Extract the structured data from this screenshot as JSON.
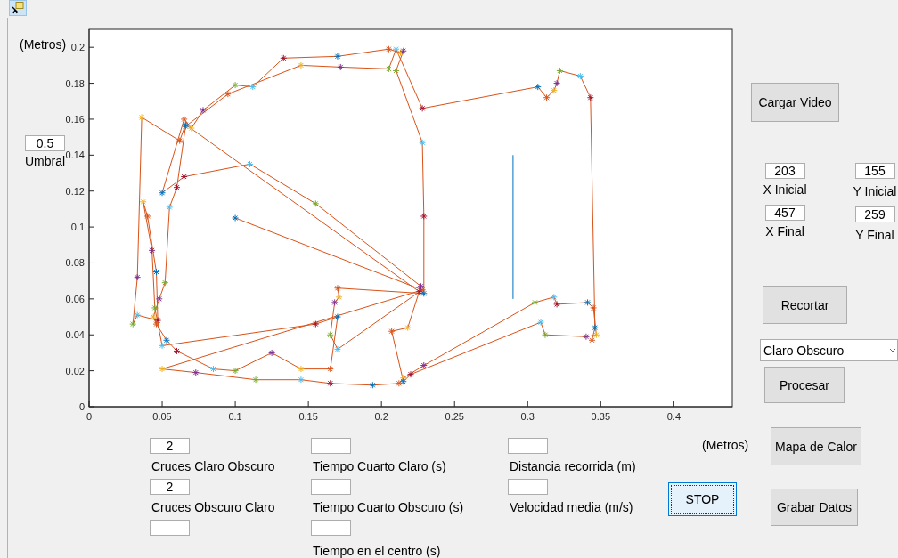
{
  "threshold": {
    "value": "0.5",
    "label": "Umbral"
  },
  "plot": {
    "y_unit": "(Metros)",
    "chart_data": {
      "type": "line",
      "xlim": [
        0,
        0.44
      ],
      "ylim": [
        0,
        0.21
      ],
      "xticks": [
        {
          "value": 0,
          "label": "0"
        },
        {
          "value": 0.05,
          "label": "0.05"
        },
        {
          "value": 0.1,
          "label": "0.1"
        },
        {
          "value": 0.15,
          "label": "0.15"
        },
        {
          "value": 0.2,
          "label": "0.2"
        },
        {
          "value": 0.25,
          "label": "0.25"
        },
        {
          "value": 0.3,
          "label": "0.3"
        },
        {
          "value": 0.35,
          "label": "0.35"
        },
        {
          "value": 0.4,
          "label": "0.4"
        }
      ],
      "yticks": [
        {
          "value": 0,
          "label": "0"
        },
        {
          "value": 0.02,
          "label": "0.02"
        },
        {
          "value": 0.04,
          "label": "0.04"
        },
        {
          "value": 0.06,
          "label": "0.06"
        },
        {
          "value": 0.08,
          "label": "0.08"
        },
        {
          "value": 0.1,
          "label": "0.1"
        },
        {
          "value": 0.12,
          "label": "0.12"
        },
        {
          "value": 0.14,
          "label": "0.14"
        },
        {
          "value": 0.16,
          "label": "0.16"
        },
        {
          "value": 0.18,
          "label": "0.18"
        },
        {
          "value": 0.2,
          "label": "0.2"
        }
      ],
      "series": [
        {
          "color": "#d95319",
          "marker": "cross",
          "x": [
            0.1,
            0.228,
            0.05,
            0.073,
            0.114,
            0.145,
            0.165,
            0.194,
            0.212,
            0.215,
            0.229,
            0.305,
            0.318,
            0.32,
            0.341,
            0.345,
            0.347,
            0.34,
            0.312,
            0.309,
            0.22,
            0.215,
            0.207,
            0.218,
            0.227,
            0.155,
            0.11,
            0.065,
            0.05,
            0.065,
            0.07,
            0.078,
            0.1,
            0.112,
            0.133,
            0.17,
            0.205,
            0.213,
            0.215,
            0.21,
            0.228,
            0.229,
            0.229,
            0.17,
            0.171,
            0.168,
            0.165,
            0.17,
            0.226,
            0.066,
            0.062,
            0.036,
            0.033,
            0.03,
            0.033,
            0.047,
            0.046,
            0.04,
            0.037,
            0.043,
            0.045,
            0.05,
            0.155,
            0.17,
            0.165,
            0.145,
            0.125,
            0.1,
            0.085,
            0.06,
            0.053,
            0.046,
            0.044,
            0.048,
            0.052,
            0.055,
            0.06,
            0.066,
            0.095,
            0.145,
            0.172,
            0.205,
            0.21,
            0.228,
            0.307,
            0.313,
            0.318,
            0.32,
            0.322,
            0.336,
            0.343,
            0.346,
            0.344
          ],
          "values": [
            0.105,
            0.065,
            0.021,
            0.019,
            0.015,
            0.015,
            0.013,
            0.012,
            0.013,
            0.016,
            0.023,
            0.058,
            0.061,
            0.057,
            0.058,
            0.055,
            0.04,
            0.039,
            0.04,
            0.047,
            0.018,
            0.014,
            0.042,
            0.044,
            0.067,
            0.113,
            0.135,
            0.128,
            0.119,
            0.16,
            0.155,
            0.165,
            0.179,
            0.178,
            0.194,
            0.195,
            0.199,
            0.197,
            0.198,
            0.187,
            0.147,
            0.106,
            0.063,
            0.066,
            0.061,
            0.058,
            0.04,
            0.032,
            0.064,
            0.157,
            0.148,
            0.161,
            0.072,
            0.046,
            0.051,
            0.048,
            0.075,
            0.106,
            0.114,
            0.087,
            0.055,
            0.034,
            0.046,
            0.05,
            0.021,
            0.021,
            0.03,
            0.02,
            0.021,
            0.031,
            0.037,
            0.046,
            0.05,
            0.06,
            0.069,
            0.111,
            0.122,
            0.156,
            0.174,
            0.19,
            0.189,
            0.188,
            0.199,
            0.166,
            0.178,
            0.172,
            0.176,
            0.18,
            0.187,
            0.184,
            0.172,
            0.044,
            0.037
          ]
        },
        {
          "color": "#0072bd",
          "x": [
            0.29,
            0.29
          ],
          "values": [
            0.06,
            0.14
          ]
        }
      ]
    }
  },
  "crop": [
    {
      "value": "203",
      "label": "X Inicial"
    },
    {
      "value": "155",
      "label": "Y Inicial"
    },
    {
      "value": "457",
      "label": "X Final"
    },
    {
      "value": "259",
      "label": "Y Final"
    }
  ],
  "buttons": {
    "load_video": "Cargar Video",
    "crop": "Recortar",
    "process": "Procesar",
    "heat_map": "Mapa de Calor",
    "save": "Grabar Datos",
    "stop": "STOP"
  },
  "mode_select": {
    "value": "Claro Obscuro"
  },
  "results": [
    [
      {
        "kind": "field",
        "value": "2",
        "label": "Cruces Claro Obscuro"
      },
      {
        "kind": "field",
        "value": "2",
        "label": "Cruces Obscuro Claro"
      },
      {
        "kind": "field"
      }
    ],
    [
      {
        "kind": "field",
        "label": "Tiempo Cuarto Claro (s)"
      },
      {
        "kind": "field",
        "label": "Tiempo Cuarto Obscuro (s)"
      },
      {
        "kind": "field",
        "label": "Tiempo en el centro (s)"
      }
    ],
    [
      {
        "kind": "field",
        "label": "Distancia recorrida (m)"
      },
      {
        "kind": "field",
        "label": "Velocidad media (m/s)"
      }
    ]
  ],
  "x_unit": "(Metros)"
}
